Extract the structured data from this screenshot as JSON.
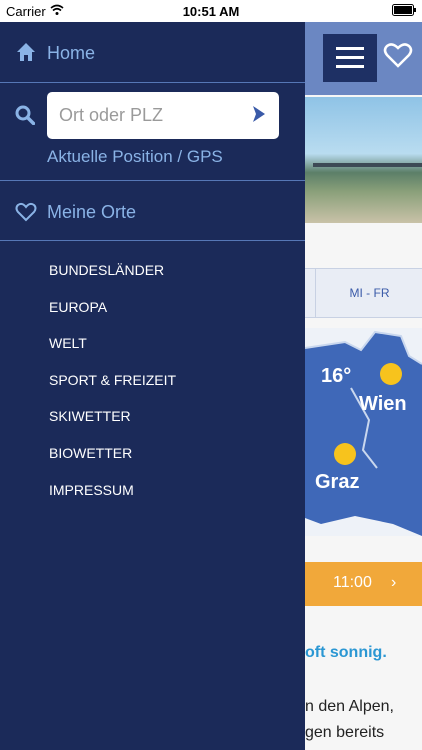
{
  "status_bar": {
    "carrier": "Carrier",
    "time": "10:51 AM"
  },
  "drawer": {
    "home_label": "Home",
    "search": {
      "placeholder": "Ort oder PLZ"
    },
    "gps_label": "Aktuelle Position / GPS",
    "favorites_label": "Meine Orte",
    "nav_items": [
      {
        "label": "BUNDESLÄNDER"
      },
      {
        "label": "EUROPA"
      },
      {
        "label": "WELT"
      },
      {
        "label": "SPORT & FREIZEIT"
      },
      {
        "label": "SKIWETTER"
      },
      {
        "label": "BIOWETTER"
      },
      {
        "label": "IMPRESSUM"
      }
    ]
  },
  "background": {
    "tab_label": "MI - FR",
    "map": {
      "temp_1": "16°",
      "city_1": "Wien",
      "city_2": "Graz"
    },
    "time_label": "11:00",
    "headline": "oft sonnig.",
    "body_line_1": "n den Alpen,",
    "body_line_2": "gen bereits"
  },
  "colors": {
    "drawer_bg": "#1b2a59",
    "accent_text": "#8ab3e6",
    "header_bg": "#6b87c2",
    "time_bar": "#f1a83a"
  }
}
